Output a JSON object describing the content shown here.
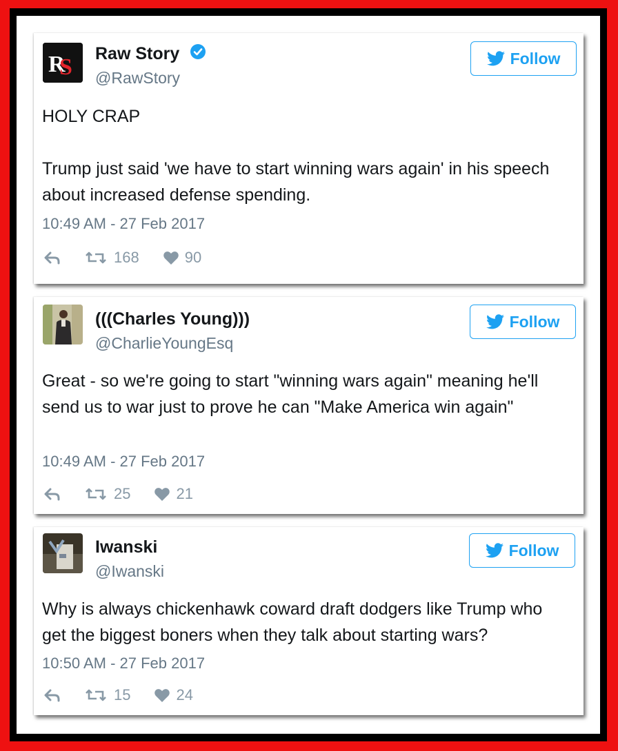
{
  "tweets": [
    {
      "display_name": "Raw Story",
      "handle": "@RawStory",
      "verified": true,
      "avatar_text": "RS",
      "follow_label": "Follow",
      "paragraphs": [
        "HOLY CRAP",
        "Trump just said 'we have to start winning wars again' in his speech about increased defense spending."
      ],
      "timestamp": "10:49 AM - 27 Feb 2017",
      "retweets": "168",
      "likes": "90"
    },
    {
      "display_name": "(((Charles Young)))",
      "handle": "@CharlieYoungEsq",
      "verified": false,
      "follow_label": "Follow",
      "paragraphs": [
        "Great - so we're going to start \"winning wars again\" meaning he'll send us to war just to prove he can \"Make America win again\""
      ],
      "timestamp": "10:49 AM - 27 Feb 2017",
      "retweets": "25",
      "likes": "21"
    },
    {
      "display_name": "Iwanski",
      "handle": "@Iwanski",
      "verified": false,
      "follow_label": "Follow",
      "paragraphs": [
        "Why is always chickenhawk coward draft dodgers like Trump who get the biggest boners when they talk about starting wars?"
      ],
      "timestamp": "10:50 AM - 27 Feb 2017",
      "retweets": "15",
      "likes": "24"
    }
  ],
  "colors": {
    "frame_outer": "#ee1111",
    "frame_inner": "#000000",
    "twitter_blue": "#1da1f2",
    "text_gray": "#657786",
    "icon_gray": "#8899a6"
  },
  "icons": {
    "verified": "verified-badge-icon",
    "bird": "twitter-bird-icon",
    "reply": "reply-icon",
    "retweet": "retweet-icon",
    "like": "heart-icon"
  }
}
